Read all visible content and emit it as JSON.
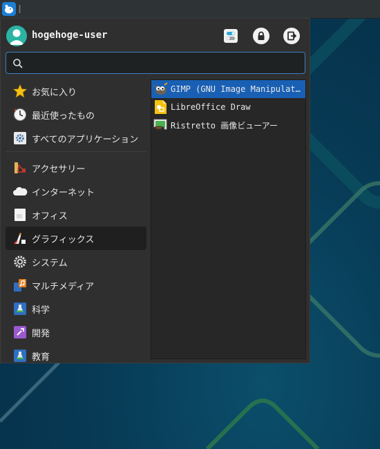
{
  "panel": {
    "whisker_icon": "xfce-mouse-icon",
    "handle_icon": "panel-handle-icon"
  },
  "user": {
    "name": "hogehoge-user",
    "avatar_icon": "user-avatar-icon"
  },
  "header_actions": [
    {
      "icon": "settings-toggle-icon"
    },
    {
      "icon": "lock-icon"
    },
    {
      "icon": "logout-icon"
    }
  ],
  "search": {
    "value": "",
    "placeholder": ""
  },
  "categories": [
    {
      "label": "お気に入り",
      "icon": "star-icon"
    },
    {
      "label": "最近使ったもの",
      "icon": "clock-icon"
    },
    {
      "label": "すべてのアプリケーション",
      "icon": "gear-icon"
    },
    {
      "label": "アクセサリー",
      "icon": "accessories-icon"
    },
    {
      "label": "インターネット",
      "icon": "cloud-icon"
    },
    {
      "label": "オフィス",
      "icon": "office-icon"
    },
    {
      "label": "グラフィックス",
      "icon": "graphics-icon",
      "active": true
    },
    {
      "label": "システム",
      "icon": "system-gear-icon"
    },
    {
      "label": "マルチメディア",
      "icon": "multimedia-icon"
    },
    {
      "label": "科学",
      "icon": "science-flask-icon"
    },
    {
      "label": "開発",
      "icon": "development-icon"
    },
    {
      "label": "教育",
      "icon": "education-icon"
    }
  ],
  "apps": [
    {
      "label": "GIMP (GNU Image Manipulat…",
      "icon": "gimp-icon",
      "selected": true
    },
    {
      "label": "LibreOffice Draw",
      "icon": "libreoffice-draw-icon"
    },
    {
      "label": "Ristretto 画像ビューアー",
      "icon": "ristretto-icon"
    }
  ],
  "colors": {
    "accent": "#1960b4",
    "search_border": "#3d7fc4",
    "menu_bg": "#2f2f2f"
  }
}
